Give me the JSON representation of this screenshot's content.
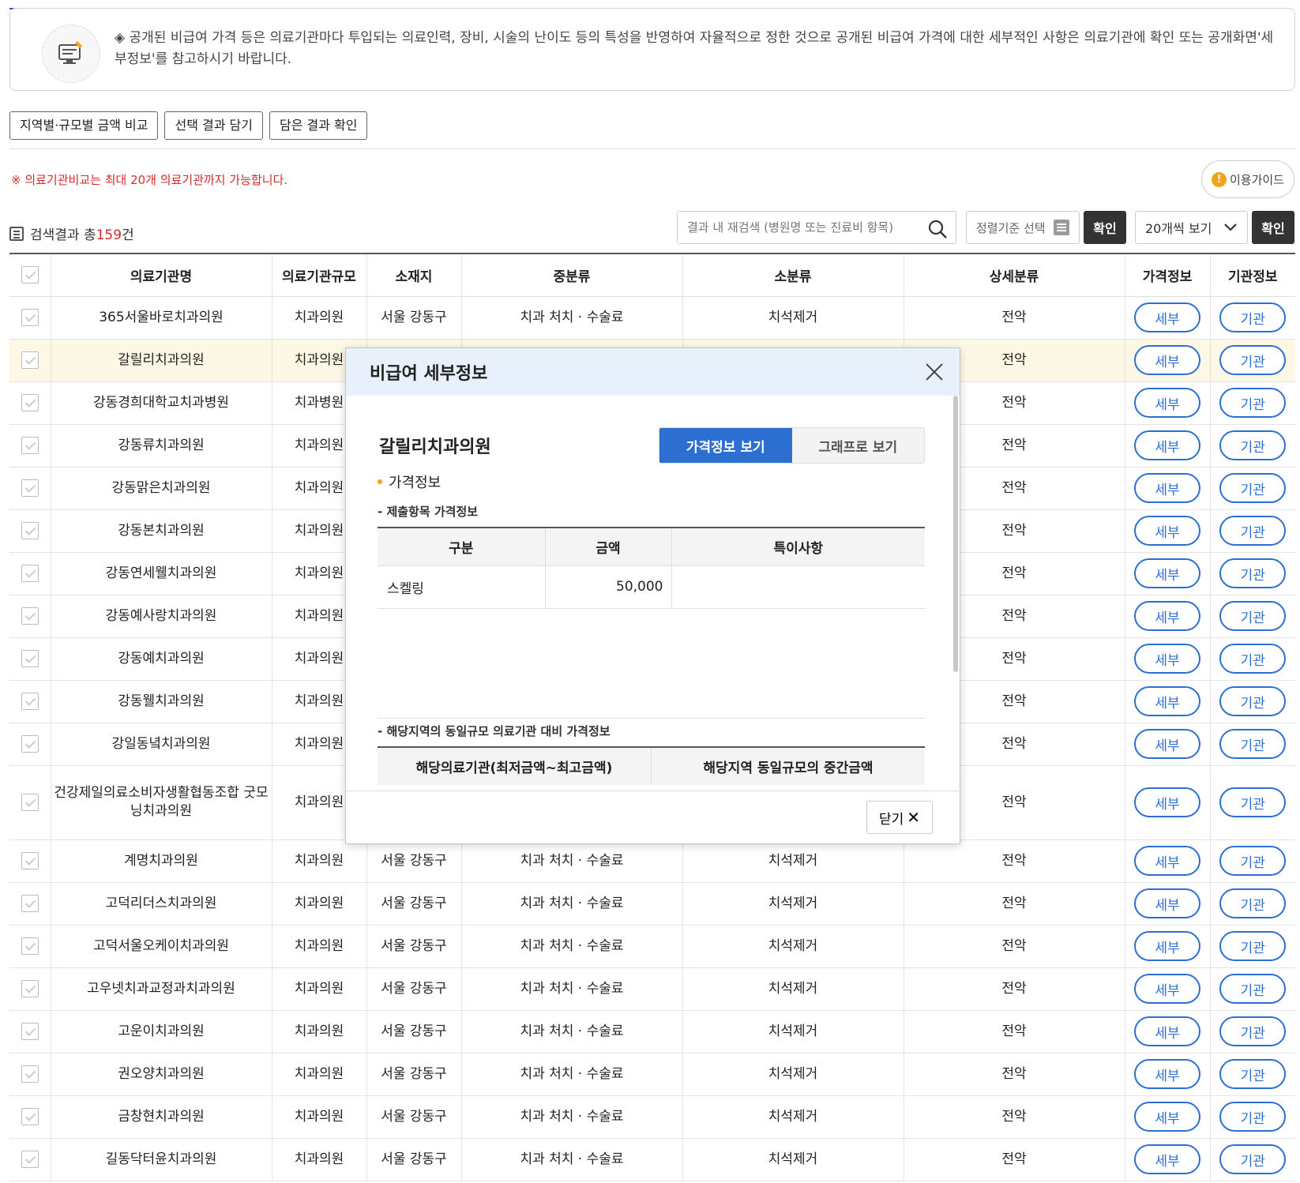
{
  "notice": {
    "text": "◈ 공개된 비급여 가격 등은 의료기관마다 투입되는 의료인력, 장비, 시술의 난이도 등의 특성을 반영하여 자율적으로 정한 것으로 공개된 비급여 가격에 대한 세부적인 사항은 의료기관에 확인 또는 공개화면'세부정보'를 참고하시기 바랍니다.",
    "icon": "clinic-display-icon"
  },
  "top_buttons": [
    "지역별·규모별 금액 비교",
    "선택 결과 담기",
    "담은 결과 확인"
  ],
  "warning": "※ 의료기관비교는 최대 20개 의료기관까지 가능합니다.",
  "guide": {
    "label": "이용가이드",
    "icon": "!"
  },
  "result_count": {
    "prefix": "검색결과 총",
    "count": "159",
    "suffix": "건"
  },
  "search": {
    "placeholder": "결과 내 재검색 (병원명 또는 진료비 항목)"
  },
  "sort": {
    "label": "정렬기준 선택"
  },
  "confirm_label": "확인",
  "per_page": {
    "selected": "20개씩 보기"
  },
  "table": {
    "headers": [
      "",
      "의료기관명",
      "의료기관규모",
      "소재지",
      "중분류",
      "소분류",
      "상세분류",
      "가격정보",
      "기관정보"
    ],
    "detail_btn": "세부",
    "org_btn": "기관",
    "rows": [
      {
        "name": "365서울바로치과의원",
        "size": "치과의원",
        "location": "서울 강동구",
        "mid": "치과 처치 · 수술료",
        "sub": "치석제거",
        "detail": "전악"
      },
      {
        "name": "갈릴리치과의원",
        "size": "치과의원",
        "location": "",
        "mid": "",
        "sub": "",
        "detail": "전악"
      },
      {
        "name": "강동경희대학교치과병원",
        "size": "치과병원",
        "location": "",
        "mid": "",
        "sub": "",
        "detail": "전악"
      },
      {
        "name": "강동류치과의원",
        "size": "치과의원",
        "location": "",
        "mid": "",
        "sub": "",
        "detail": "전악"
      },
      {
        "name": "강동맑은치과의원",
        "size": "치과의원",
        "location": "",
        "mid": "",
        "sub": "",
        "detail": "전악"
      },
      {
        "name": "강동본치과의원",
        "size": "치과의원",
        "location": "",
        "mid": "",
        "sub": "",
        "detail": "전악"
      },
      {
        "name": "강동연세웰치과의원",
        "size": "치과의원",
        "location": "",
        "mid": "",
        "sub": "",
        "detail": "전악"
      },
      {
        "name": "강동예사랑치과의원",
        "size": "치과의원",
        "location": "",
        "mid": "",
        "sub": "",
        "detail": "전악"
      },
      {
        "name": "강동예치과의원",
        "size": "치과의원",
        "location": "",
        "mid": "",
        "sub": "",
        "detail": "전악"
      },
      {
        "name": "강동웰치과의원",
        "size": "치과의원",
        "location": "",
        "mid": "",
        "sub": "",
        "detail": "전악"
      },
      {
        "name": "강일동녘치과의원",
        "size": "치과의원",
        "location": "",
        "mid": "",
        "sub": "",
        "detail": "전악"
      },
      {
        "name": "건강제일의료소비자생활협동조합 굿모닝치과의원",
        "size": "치과의원",
        "location": "",
        "mid": "",
        "sub": "",
        "detail": "전악"
      },
      {
        "name": "계명치과의원",
        "size": "치과의원",
        "location": "서울 강동구",
        "mid": "치과 처치 · 수술료",
        "sub": "치석제거",
        "detail": "전악"
      },
      {
        "name": "고덕리더스치과의원",
        "size": "치과의원",
        "location": "서울 강동구",
        "mid": "치과 처치 · 수술료",
        "sub": "치석제거",
        "detail": "전악"
      },
      {
        "name": "고덕서울오케이치과의원",
        "size": "치과의원",
        "location": "서울 강동구",
        "mid": "치과 처치 · 수술료",
        "sub": "치석제거",
        "detail": "전악"
      },
      {
        "name": "고우넷치과교정과치과의원",
        "size": "치과의원",
        "location": "서울 강동구",
        "mid": "치과 처치 · 수술료",
        "sub": "치석제거",
        "detail": "전악"
      },
      {
        "name": "고운이치과의원",
        "size": "치과의원",
        "location": "서울 강동구",
        "mid": "치과 처치 · 수술료",
        "sub": "치석제거",
        "detail": "전악"
      },
      {
        "name": "권오양치과의원",
        "size": "치과의원",
        "location": "서울 강동구",
        "mid": "치과 처치 · 수술료",
        "sub": "치석제거",
        "detail": "전악"
      },
      {
        "name": "금창현치과의원",
        "size": "치과의원",
        "location": "서울 강동구",
        "mid": "치과 처치 · 수술료",
        "sub": "치석제거",
        "detail": "전악"
      },
      {
        "name": "길동닥터윤치과의원",
        "size": "치과의원",
        "location": "서울 강동구",
        "mid": "치과 처치 · 수술료",
        "sub": "치석제거",
        "detail": "전악"
      }
    ]
  },
  "modal": {
    "title": "비급여 세부정보",
    "clinic_name": "갈릴리치과의원",
    "tabs": [
      "가격정보 보기",
      "그래프로 보기"
    ],
    "section_title": "가격정보",
    "sub_title_1": "- 제출항목 가격정보",
    "price_headers": [
      "구분",
      "금액",
      "특이사항"
    ],
    "price_rows": [
      {
        "category": "스켈링",
        "amount": "50,000",
        "note": ""
      }
    ],
    "sub_title_2": "- 해당지역의 동일규모 의료기관 대비 가격정보",
    "compare_headers": [
      "해당의료기관(최저금액~최고금액)",
      "해당지역 동일규모의 중간금액"
    ],
    "close_label": "닫기"
  }
}
